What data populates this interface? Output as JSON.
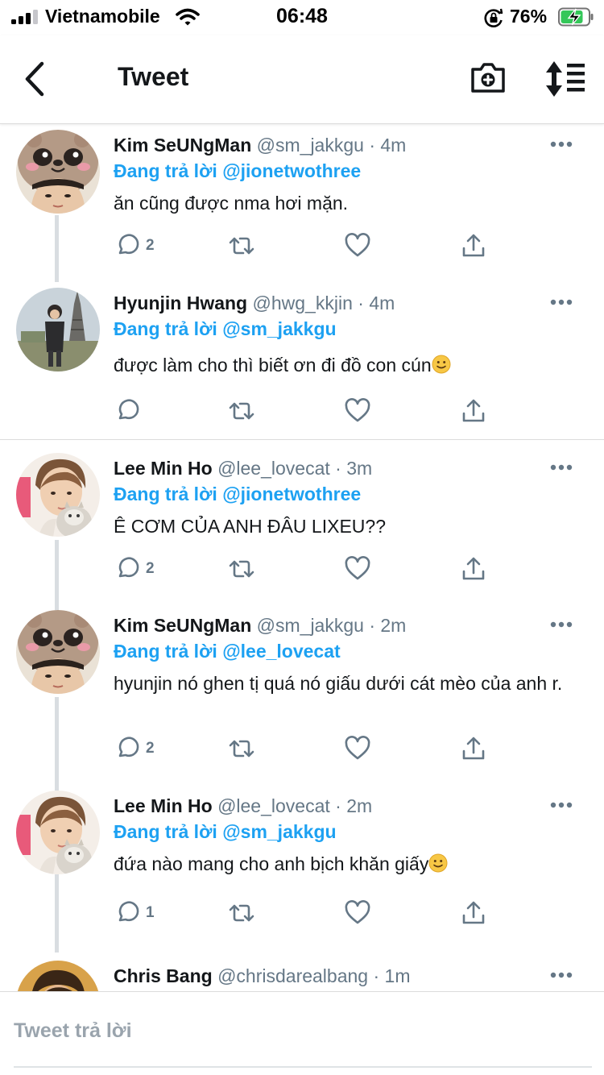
{
  "status_bar": {
    "carrier": "Vietnamobile",
    "time": "06:48",
    "battery_percent": "76%",
    "battery_level": 0.76,
    "signal_bars": 3
  },
  "nav": {
    "title": "Tweet",
    "icons": [
      "back-icon",
      "camera-icon",
      "sort-icon"
    ]
  },
  "colors": {
    "accent": "#1da1f2",
    "text_primary": "#14171a",
    "text_secondary": "#657786",
    "battery_green": "#34c759"
  },
  "tweets": [
    {
      "name": "Kim SeUNgMan",
      "handle": "@sm_jakkgu",
      "time": "4m",
      "reply_prefix": "Đang trả lời",
      "reply_to": "@jionetwothree",
      "text": "ăn cũng được nma hơi mặn.",
      "reply_count": "2"
    },
    {
      "name": "Hyunjin Hwang",
      "handle": "@hwg_kkjin",
      "time": "4m",
      "reply_prefix": "Đang trả lời",
      "reply_to": "@sm_jakkgu",
      "text": "được làm cho thì biết ơn đi đồ con cún",
      "reply_count": ""
    },
    {
      "name": "Lee Min Ho",
      "handle": "@lee_lovecat",
      "time": "3m",
      "reply_prefix": "Đang trả lời",
      "reply_to": "@jionetwothree",
      "text": "Ê CƠM CỦA ANH ĐÂU LIXEU??",
      "reply_count": "2"
    },
    {
      "name": "Kim SeUNgMan",
      "handle": "@sm_jakkgu",
      "time": "2m",
      "reply_prefix": "Đang trả lời",
      "reply_to": "@lee_lovecat",
      "text": "hyunjin nó ghen tị quá nó giấu dưới cát mèo của anh r.",
      "reply_count": "2"
    },
    {
      "name": "Lee Min Ho",
      "handle": "@lee_lovecat",
      "time": "2m",
      "reply_prefix": "Đang trả lời",
      "reply_to": "@sm_jakkgu",
      "text": "đứa nào mang cho anh bịch khăn giấy",
      "reply_count": "1"
    },
    {
      "name": "Chris Bang",
      "handle": "@chrisdarealbang",
      "time": "1m"
    }
  ],
  "compose": {
    "placeholder": "Tweet trả lời"
  }
}
